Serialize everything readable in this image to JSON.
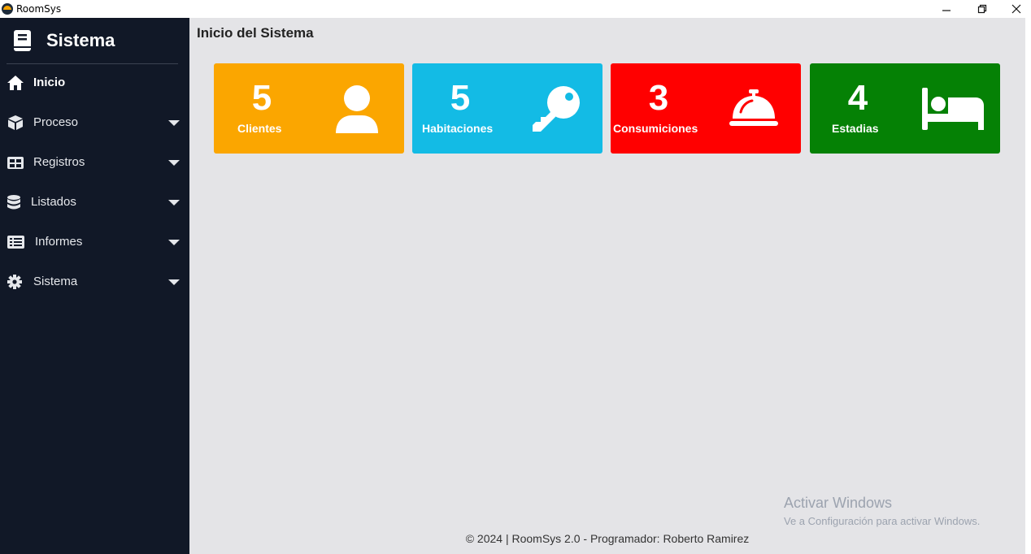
{
  "window": {
    "title": "RoomSys",
    "minimize_icon": "minimize-icon",
    "maximize_icon": "restore-icon",
    "close_icon": "close-icon"
  },
  "sidebar": {
    "brand": {
      "title": "Sistema",
      "icon": "book-icon"
    },
    "items": [
      {
        "label": "Inicio",
        "icon": "home-icon",
        "has_submenu": false
      },
      {
        "label": "Proceso",
        "icon": "box-icon",
        "has_submenu": true
      },
      {
        "label": "Registros",
        "icon": "table-icon",
        "has_submenu": true
      },
      {
        "label": "Listados",
        "icon": "database-icon",
        "has_submenu": true
      },
      {
        "label": "Informes",
        "icon": "list-icon",
        "has_submenu": true
      },
      {
        "label": "Sistema",
        "icon": "gear-icon",
        "has_submenu": true
      }
    ]
  },
  "main": {
    "title": "Inicio del Sistema",
    "cards": [
      {
        "count": "5",
        "label": "Clientes",
        "icon": "user-icon",
        "color": "#fba600"
      },
      {
        "count": "5",
        "label": "Habitaciones",
        "icon": "key-icon",
        "color": "#13bbe5"
      },
      {
        "count": "3",
        "label": "Consumiciones",
        "icon": "service-bell-icon",
        "color": "#ff0000"
      },
      {
        "count": "4",
        "label": "Estadias",
        "icon": "bed-icon",
        "color": "#058105"
      }
    ]
  },
  "watermark": {
    "line1": "Activar Windows",
    "line2": "Ve a Configuración para activar Windows."
  },
  "footer": {
    "text": "© 2024 | RoomSys 2.0 - Programador: Roberto Ramirez"
  },
  "colors": {
    "sidebar_bg": "#111827",
    "main_bg": "#e4e4e7",
    "clientes": "#fba600",
    "habitaciones": "#13bbe5",
    "consumiciones": "#ff0000",
    "estadias": "#058105"
  }
}
